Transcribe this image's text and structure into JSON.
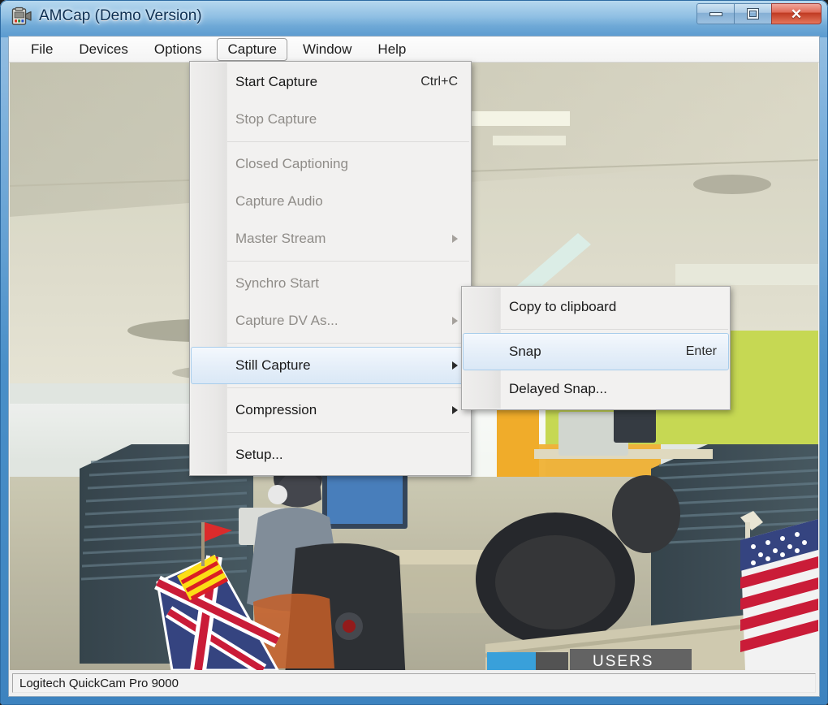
{
  "window": {
    "title": "AMCap (Demo Version)",
    "app_icon": "camcorder-icon",
    "controls": {
      "minimize": "Minimize",
      "maximize": "Maximize",
      "close": "Close",
      "close_glyph": "✕"
    },
    "frame_color": "#4a8fc8",
    "close_color": "#c03a22"
  },
  "menubar": {
    "items": [
      {
        "label": "File",
        "active": false
      },
      {
        "label": "Devices",
        "active": false
      },
      {
        "label": "Options",
        "active": false
      },
      {
        "label": "Capture",
        "active": true
      },
      {
        "label": "Window",
        "active": false
      },
      {
        "label": "Help",
        "active": false
      }
    ]
  },
  "capture_menu": {
    "items": [
      {
        "label": "Start Capture",
        "accel": "Ctrl+C",
        "disabled": false,
        "submenu": false,
        "selected": false
      },
      {
        "label": "Stop Capture",
        "accel": "",
        "disabled": true,
        "submenu": false,
        "selected": false
      },
      {
        "separator": true
      },
      {
        "label": "Closed Captioning",
        "accel": "",
        "disabled": true,
        "submenu": false,
        "selected": false
      },
      {
        "label": "Capture Audio",
        "accel": "",
        "disabled": true,
        "submenu": false,
        "selected": false
      },
      {
        "label": "Master Stream",
        "accel": "",
        "disabled": true,
        "submenu": true,
        "selected": false
      },
      {
        "separator": true
      },
      {
        "label": "Synchro Start",
        "accel": "",
        "disabled": true,
        "submenu": false,
        "selected": false
      },
      {
        "label": "Capture DV As...",
        "accel": "",
        "disabled": true,
        "submenu": true,
        "selected": false
      },
      {
        "separator": true
      },
      {
        "label": "Still Capture",
        "accel": "",
        "disabled": false,
        "submenu": true,
        "selected": true
      },
      {
        "separator": true
      },
      {
        "label": "Compression",
        "accel": "",
        "disabled": false,
        "submenu": true,
        "selected": false
      },
      {
        "separator": true
      },
      {
        "label": "Setup...",
        "accel": "",
        "disabled": false,
        "submenu": false,
        "selected": false
      }
    ]
  },
  "still_capture_submenu": {
    "items": [
      {
        "label": "Copy to clipboard",
        "accel": "",
        "disabled": false,
        "selected": false
      },
      {
        "separator": true
      },
      {
        "label": "Snap",
        "accel": "Enter",
        "disabled": false,
        "selected": true
      },
      {
        "label": "Delayed Snap...",
        "accel": "",
        "disabled": false,
        "selected": false
      }
    ]
  },
  "statusbar": {
    "device": "Logitech QuickCam Pro 9000"
  },
  "video_preview": {
    "description": "Live webcam view of an open-plan office: suspended white ceiling tiles, a person in a grey t-shirt wearing headphones seated at a desk with dual monitors, dark grey cubicle dividers, a Union Jack flag and a United States flag on desk poles, a black mesh office chair, yellow and green painted walls.",
    "sign_text": "USERS"
  }
}
